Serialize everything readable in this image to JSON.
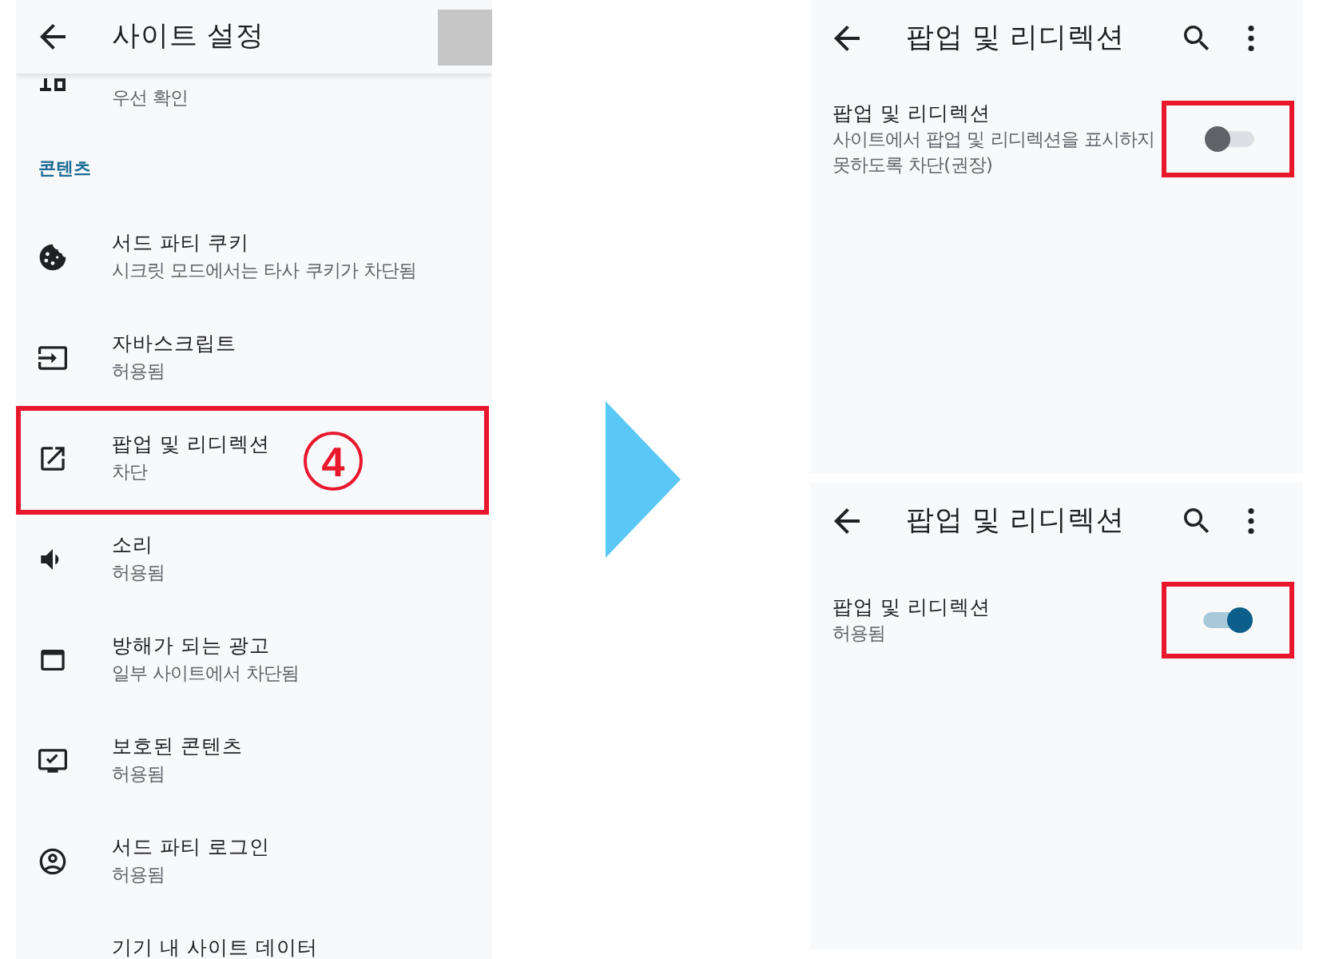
{
  "left_screen": {
    "header": {
      "title": "사이트 설정"
    },
    "partial_item": {
      "subtitle": "우선 확인"
    },
    "section": {
      "label": "콘텐츠"
    },
    "items": [
      {
        "title": "서드 파티 쿠키",
        "subtitle": "시크릿 모드에서는 타사 쿠키가 차단됨",
        "highlighted": false
      },
      {
        "title": "자바스크립트",
        "subtitle": "허용됨",
        "highlighted": false
      },
      {
        "title": "팝업 및 리디렉션",
        "subtitle": "차단",
        "highlighted": true,
        "step": "4"
      },
      {
        "title": "소리",
        "subtitle": "허용됨",
        "highlighted": false
      },
      {
        "title": "방해가 되는 광고",
        "subtitle": "일부 사이트에서 차단됨",
        "highlighted": false
      },
      {
        "title": "보호된 콘텐츠",
        "subtitle": "허용됨",
        "highlighted": false
      },
      {
        "title": "서드 파티 로그인",
        "subtitle": "허용됨",
        "highlighted": false
      },
      {
        "title": "기기 내 사이트 데이터",
        "highlighted": false
      }
    ]
  },
  "right_screens": [
    {
      "header": {
        "title": "팝업 및 리디렉션"
      },
      "setting": {
        "title": "팝업 및 리디렉션",
        "description": "사이트에서 팝업 및 리디렉션을 표시하지 못하도록 차단(권장)",
        "on": false,
        "highlighted": true
      }
    },
    {
      "header": {
        "title": "팝업 및 리디렉션"
      },
      "setting": {
        "title": "팝업 및 리디렉션",
        "description": "허용됨",
        "on": true,
        "highlighted": true
      }
    }
  ]
}
